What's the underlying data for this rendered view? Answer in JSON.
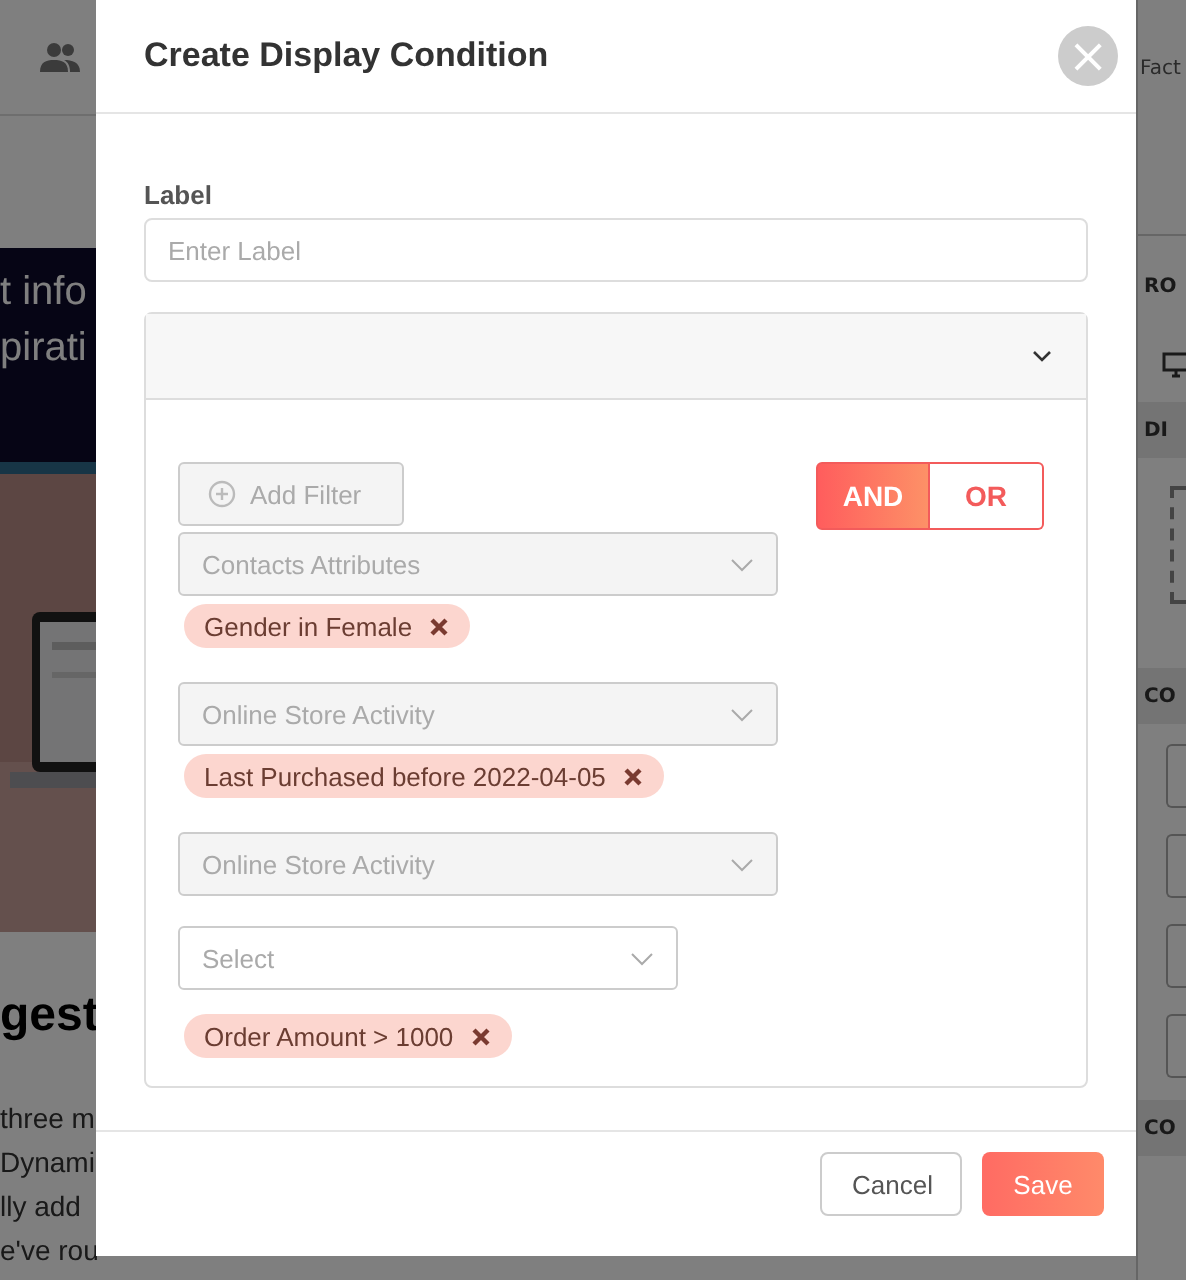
{
  "background": {
    "top_bar": {
      "right_label": "Fact"
    },
    "banner_lines": [
      "t info",
      "pirati"
    ],
    "heading": "gest",
    "paragraph_lines": [
      "three m",
      "Dynami",
      "lly add",
      "e've rou"
    ],
    "side_sections": [
      "RO",
      "DI",
      "CO",
      "CO"
    ]
  },
  "modal": {
    "title": "Create Display Condition",
    "close": "×",
    "label": {
      "text": "Label",
      "placeholder": "Enter Label"
    },
    "add_filter": "Add Filter",
    "operators": [
      {
        "label": "AND",
        "selected": true
      },
      {
        "label": "OR",
        "selected": false
      }
    ],
    "filters": [
      {
        "placeholder": "Contacts Attributes",
        "disabled": true,
        "tags": [
          "Gender in Female"
        ]
      },
      {
        "placeholder": "Online Store Activity",
        "disabled": true,
        "tags": [
          "Last Purchased before 2022-04-05"
        ]
      },
      {
        "placeholder": "Online Store Activity",
        "disabled": true
      },
      {
        "placeholder": "Select",
        "disabled": false,
        "tags": [
          "Order Amount > 1000"
        ]
      }
    ],
    "buttons": [
      {
        "label": "Cancel",
        "kind": "secondary"
      },
      {
        "label": "Save",
        "kind": "primary"
      }
    ]
  }
}
